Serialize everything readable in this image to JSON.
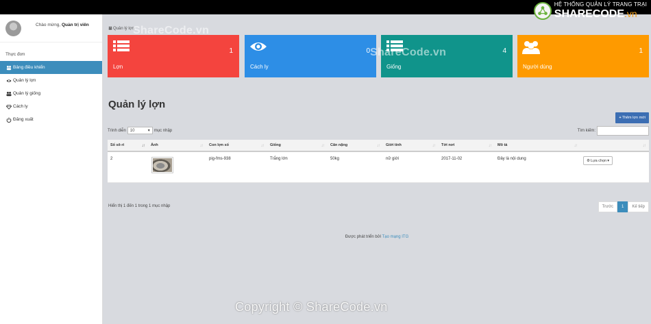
{
  "brand": {
    "system_title": "HỆ THỐNG QUẢN LÝ TRANG TRẠI",
    "logo_text": "SHARECODE",
    "logo_suffix": ".vn"
  },
  "sidebar": {
    "welcome_prefix": "Chào mừng,",
    "user_name": "Quản trị viên",
    "menu_header": "Thực đơn",
    "items": [
      {
        "label": "Bảng điều khiển",
        "icon": "dashboard-icon",
        "active": true
      },
      {
        "label": "Quản lý lợn",
        "icon": "eye-icon",
        "active": false
      },
      {
        "label": "Quản lý giống",
        "icon": "users-icon",
        "active": false
      },
      {
        "label": "Cách ly",
        "icon": "diamond-icon",
        "active": false
      },
      {
        "label": "Đăng xuất",
        "icon": "power-icon",
        "active": false
      }
    ]
  },
  "breadcrumb": {
    "label": "Quản lý lợn"
  },
  "stats": [
    {
      "label": "Lợn",
      "count": "1",
      "color": "#f4443e",
      "icon": "list-icon"
    },
    {
      "label": "Cách ly",
      "count": "0",
      "color": "#2d8ee6",
      "icon": "eye-icon"
    },
    {
      "label": "Giống",
      "count": "4",
      "color": "#10948b",
      "icon": "list-icon"
    },
    {
      "label": "Người dùng",
      "count": "1",
      "color": "#fe9a00",
      "icon": "users-icon"
    }
  ],
  "page": {
    "title": "Quản lý lợn",
    "add_button": "Thêm lợn mới"
  },
  "table_controls": {
    "show_prefix": "Trình diễn",
    "page_length": "10",
    "show_suffix": "mục nhập",
    "search_label": "Tìm kiếm:",
    "search_value": ""
  },
  "table": {
    "columns": [
      "Số sê-ri",
      "Ảnh",
      "Con lợn số",
      "Giống",
      "Cân nặng",
      "Giới tính",
      "Tới nơi",
      "Mô tả",
      ""
    ],
    "rows": [
      {
        "serial": "2",
        "pig_no": "pig-fms-938",
        "breed": "Trắng lớn",
        "weight": "50kg",
        "gender": "nữ giới",
        "arrived": "2017-11-02",
        "description": "Đây là nội dung",
        "action": "Lựa chọn"
      }
    ]
  },
  "table_footer": {
    "info": "Hiển thị 1 đến 1 trong 1 mục nhập",
    "prev": "Trước",
    "current_page": "1",
    "next": "Kế tiếp"
  },
  "footer": {
    "text": "Được phát triển bởi",
    "link": "Tạo mạng ITG"
  },
  "watermarks": {
    "top": "ShareCode.vn",
    "mid": "ShareCode.vn",
    "bottom": "Copyright © ShareCode.vn"
  },
  "colors": {
    "active_menu": "#3c8dbc",
    "primary_button": "#3c6eb3",
    "top_bar": "#000000"
  }
}
